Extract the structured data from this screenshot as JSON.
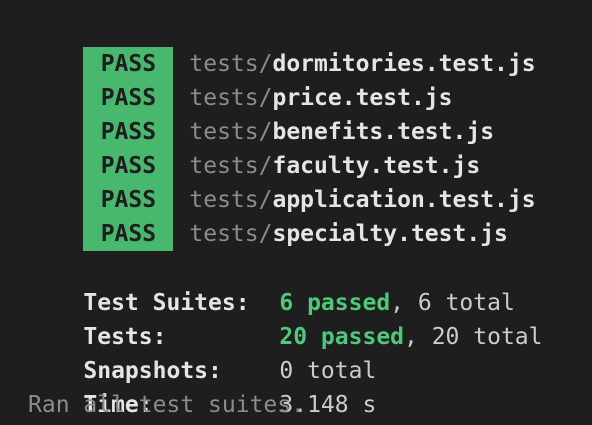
{
  "results": [
    {
      "status": "PASS",
      "dir": "tests/",
      "file": "dormitories.test.js"
    },
    {
      "status": "PASS",
      "dir": "tests/",
      "file": "price.test.js"
    },
    {
      "status": "PASS",
      "dir": "tests/",
      "file": "benefits.test.js"
    },
    {
      "status": "PASS",
      "dir": "tests/",
      "file": "faculty.test.js"
    },
    {
      "status": "PASS",
      "dir": "tests/",
      "file": "application.test.js"
    },
    {
      "status": "PASS",
      "dir": "tests/",
      "file": "specialty.test.js"
    }
  ],
  "summary": {
    "suites": {
      "label": "Test Suites:",
      "passed": "6 passed",
      "total": ", 6 total"
    },
    "tests": {
      "label": "Tests:",
      "passed": "20 passed",
      "total": ", 20 total"
    },
    "snapshots": {
      "label": "Snapshots:",
      "value": "0 total"
    },
    "time": {
      "label": "Time:",
      "value": "3.148 s"
    },
    "footer": "Ran all test suites."
  },
  "colors": {
    "background": "#1e1e1e",
    "pass_badge": "#49b86f",
    "passed_text": "#4ec87a",
    "dim_text": "#8c8c8c"
  }
}
